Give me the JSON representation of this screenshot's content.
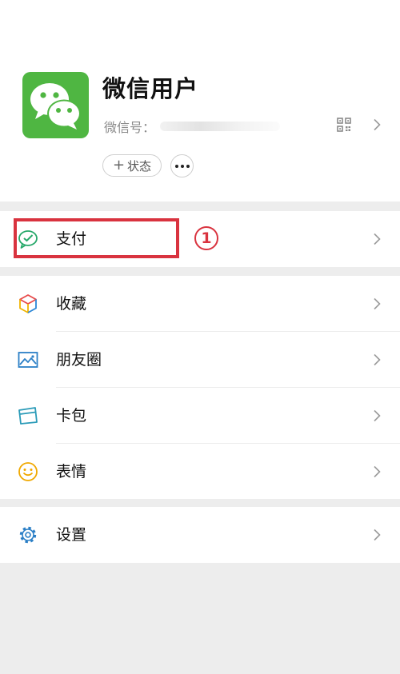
{
  "profile": {
    "nickname": "微信用户",
    "wxid_label": "微信号：",
    "status_label": "状态",
    "status_plus": "+"
  },
  "menu": {
    "pay": {
      "label": "支付",
      "icon": "wechat-pay-icon"
    },
    "favorites": {
      "label": "收藏",
      "icon": "cube-icon"
    },
    "moments": {
      "label": "朋友圈",
      "icon": "image-icon"
    },
    "cards": {
      "label": "卡包",
      "icon": "card-icon"
    },
    "stickers": {
      "label": "表情",
      "icon": "smiley-icon"
    },
    "settings": {
      "label": "设置",
      "icon": "gear-icon"
    }
  },
  "annotation": {
    "number": "1"
  },
  "colors": {
    "wechat_green": "#4fb642",
    "annotation_red": "#d9333f",
    "background": "#ededed"
  }
}
